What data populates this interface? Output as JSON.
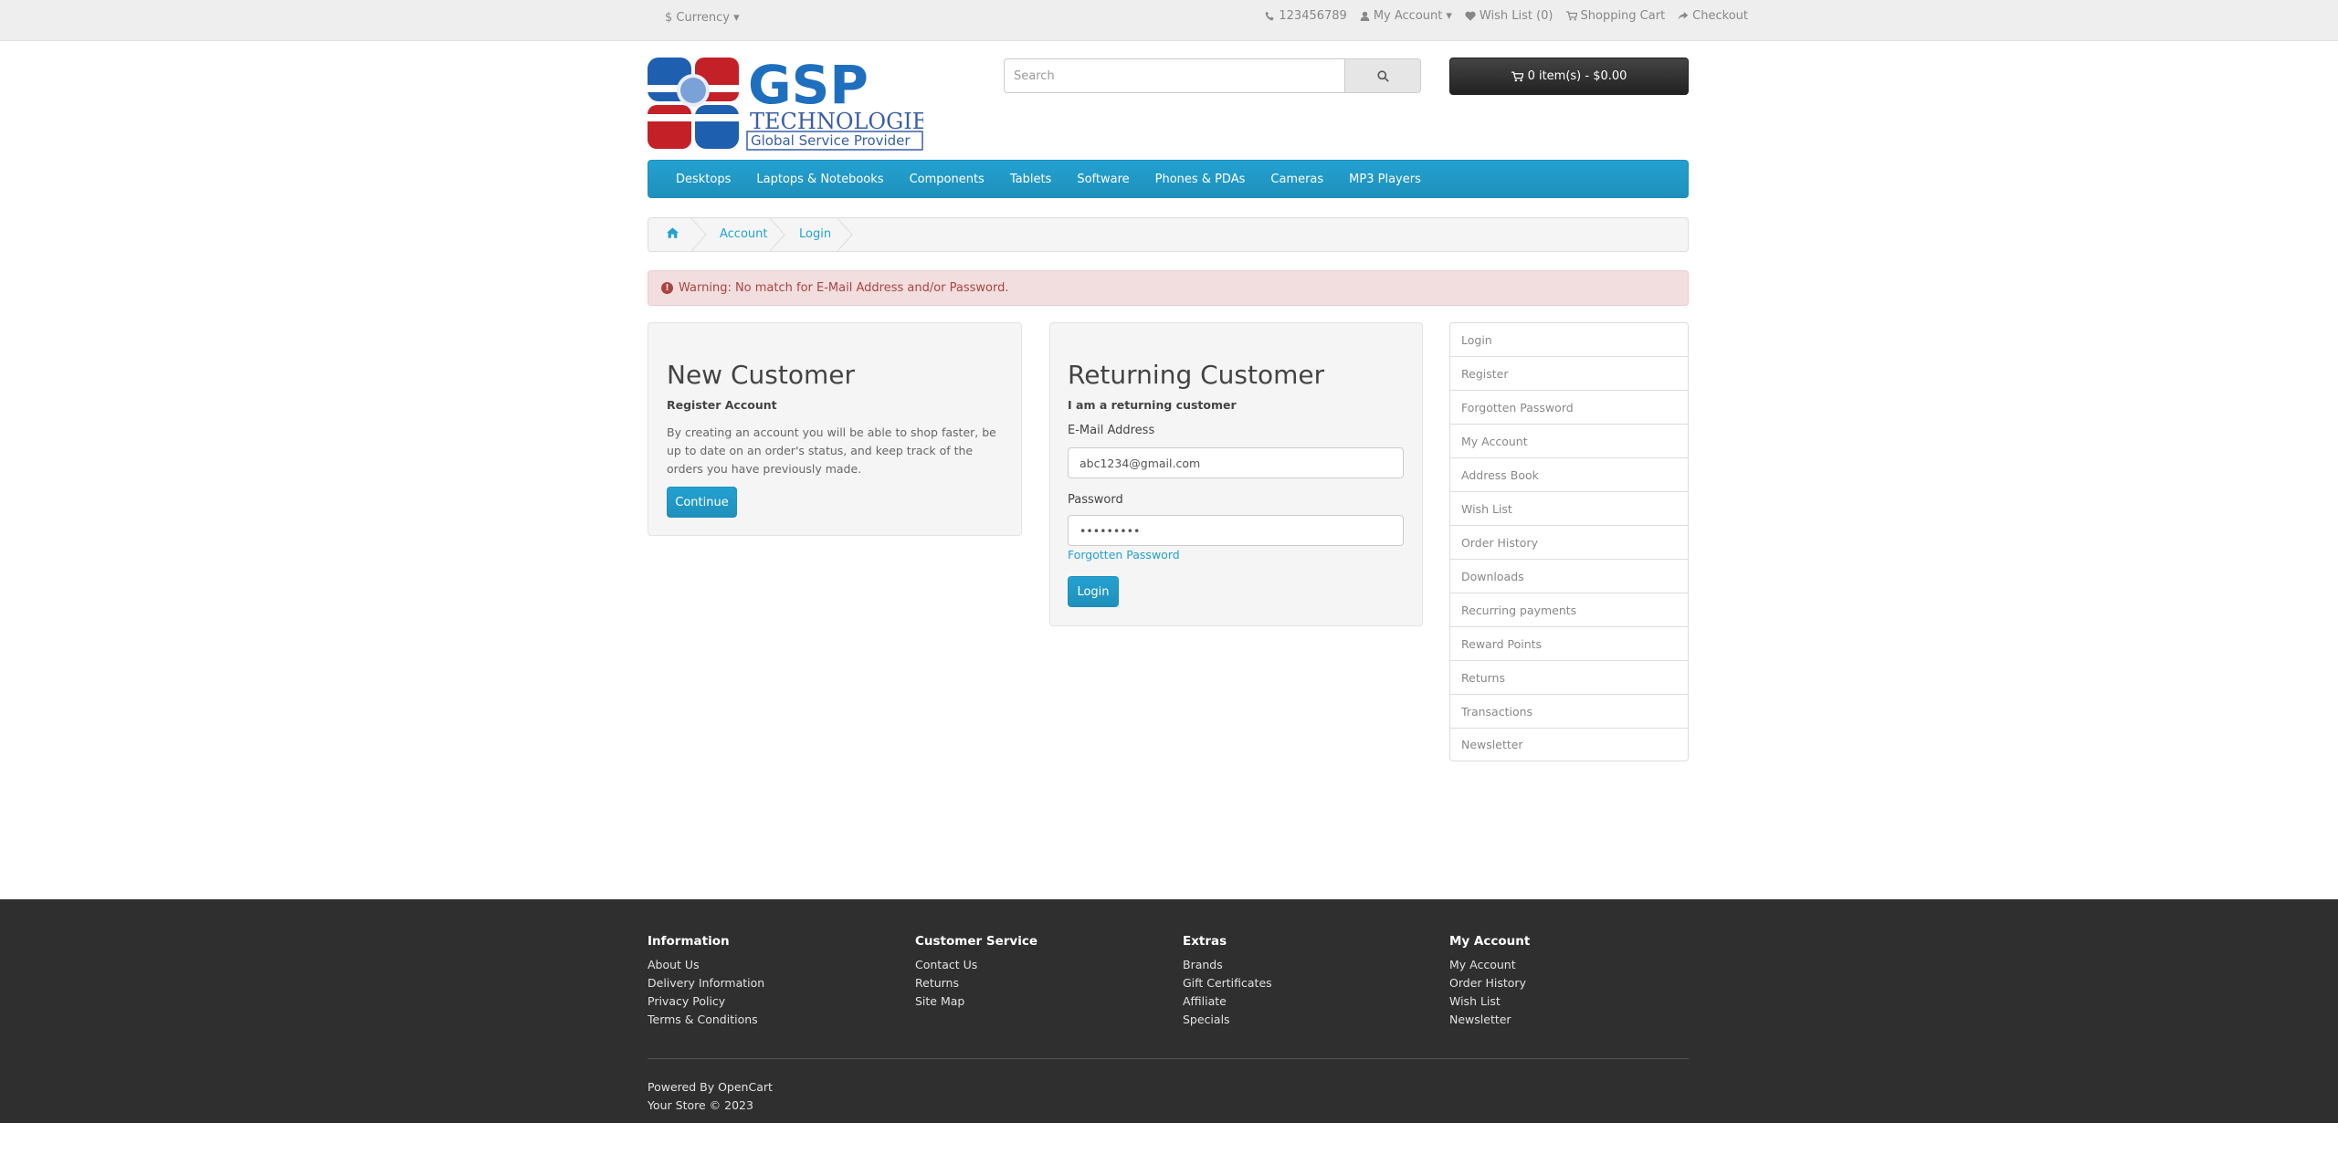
{
  "topbar": {
    "currency_symbol": "$",
    "currency_label": "Currency",
    "phone": "123456789",
    "my_account": "My Account",
    "wish_list": "Wish List (0)",
    "shopping_cart": "Shopping Cart",
    "checkout": "Checkout"
  },
  "logo": {
    "name": "GSP",
    "line1": "TECHNOLOGIES",
    "line2": "Global Service Provider"
  },
  "search": {
    "placeholder": "Search"
  },
  "cart": {
    "label": "0 item(s) - $0.00"
  },
  "menu": [
    "Desktops",
    "Laptops & Notebooks",
    "Components",
    "Tablets",
    "Software",
    "Phones & PDAs",
    "Cameras",
    "MP3 Players"
  ],
  "breadcrumb": {
    "account": "Account",
    "login": "Login"
  },
  "alert": {
    "text": "Warning: No match for E-Mail Address and/or Password."
  },
  "new_customer": {
    "title": "New Customer",
    "subtitle": "Register Account",
    "text": "By creating an account you will be able to shop faster, be up to date on an order's status, and keep track of the orders you have previously made.",
    "button": "Continue"
  },
  "returning_customer": {
    "title": "Returning Customer",
    "subtitle": "I am a returning customer",
    "email_label": "E-Mail Address",
    "email_value": "abc1234@gmail.com",
    "password_label": "Password",
    "password_value": "abc123456",
    "forgotten": "Forgotten Password",
    "button": "Login"
  },
  "sidebar": [
    "Login",
    "Register",
    "Forgotten Password",
    "My Account",
    "Address Book",
    "Wish List",
    "Order History",
    "Downloads",
    "Recurring payments",
    "Reward Points",
    "Returns",
    "Transactions",
    "Newsletter"
  ],
  "footer": {
    "information": {
      "title": "Information",
      "links": [
        "About Us",
        "Delivery Information",
        "Privacy Policy",
        "Terms & Conditions"
      ]
    },
    "customer_service": {
      "title": "Customer Service",
      "links": [
        "Contact Us",
        "Returns",
        "Site Map"
      ]
    },
    "extras": {
      "title": "Extras",
      "links": [
        "Brands",
        "Gift Certificates",
        "Affiliate",
        "Specials"
      ]
    },
    "my_account": {
      "title": "My Account",
      "links": [
        "My Account",
        "Order History",
        "Wish List",
        "Newsletter"
      ]
    },
    "powered_prefix": "Powered By",
    "powered_link": "OpenCart",
    "store": "Your Store © 2023"
  },
  "colors": {
    "accent": "#229ac8",
    "alert_bg": "#f2dede",
    "alert_text": "#a94442",
    "footer_bg": "#2f2f2f"
  }
}
